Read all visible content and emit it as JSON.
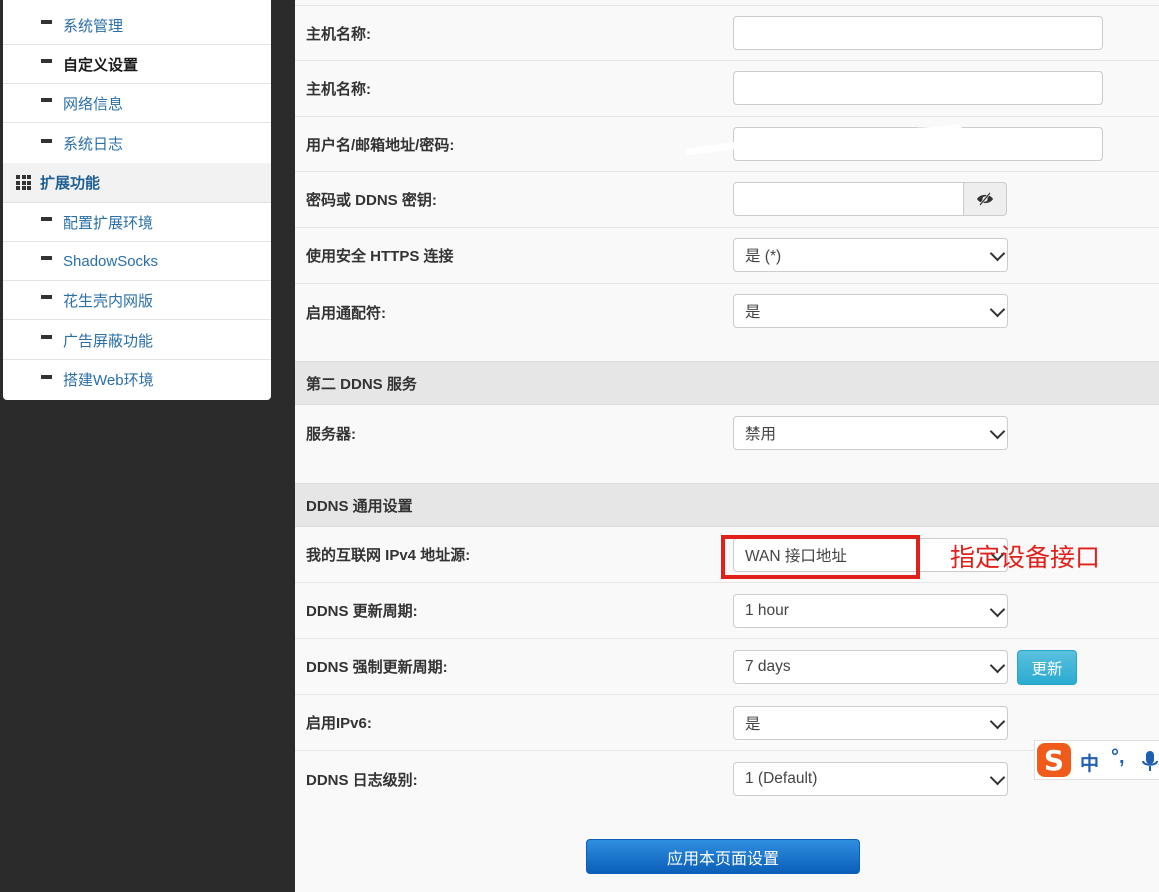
{
  "sidebar": {
    "items_top": [
      {
        "label": "系统管理",
        "active": false
      },
      {
        "label": "自定义设置",
        "active": true
      },
      {
        "label": "网络信息",
        "active": false
      },
      {
        "label": "系统日志",
        "active": false
      }
    ],
    "group": {
      "label": "扩展功能",
      "icon": "grid-icon"
    },
    "items_group": [
      {
        "label": "配置扩展环境"
      },
      {
        "label": "ShadowSocks"
      },
      {
        "label": "花生壳内网版"
      },
      {
        "label": "广告屏蔽功能"
      },
      {
        "label": "搭建Web环境"
      }
    ]
  },
  "form": {
    "hostname1": {
      "label": "主机名称:",
      "value": ""
    },
    "hostname2": {
      "label": "主机名称:",
      "value": ""
    },
    "username": {
      "label": "用户名/邮箱地址/密码:",
      "value": ""
    },
    "password": {
      "label": "密码或 DDNS 密钥:",
      "value": "",
      "toggle_icon": "eye-slash-icon"
    },
    "https": {
      "label": "使用安全 HTTPS 连接",
      "value": "是 (*)"
    },
    "wildcard": {
      "label": "启用通配符:",
      "value": "是"
    },
    "second_ddns": {
      "title": "第二 DDNS 服务",
      "server": {
        "label": "服务器:",
        "value": "禁用"
      }
    },
    "general": {
      "title": "DDNS 通用设置",
      "ipv4_source": {
        "label": "我的互联网 IPv4 地址源:",
        "value": "WAN 接口地址"
      },
      "update_period": {
        "label": "DDNS 更新周期:",
        "value": "1 hour"
      },
      "force_period": {
        "label": "DDNS 强制更新周期:",
        "value": "7 days",
        "button": "更新"
      },
      "ipv6": {
        "label": "启用IPv6:",
        "value": "是"
      },
      "log_level": {
        "label": "DDNS 日志级别:",
        "value": "1 (Default)"
      }
    },
    "apply_button": "应用本页面设置"
  },
  "annotation": {
    "text": "指定设备接口",
    "color": "#e0201b"
  },
  "ime": {
    "logo": "S",
    "mode": "中",
    "punct": "°,"
  }
}
